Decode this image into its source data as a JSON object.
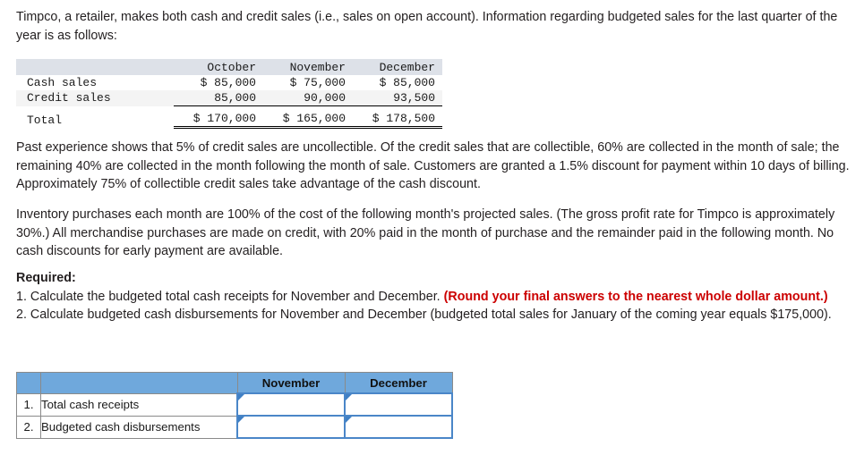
{
  "intro": {
    "text": "Timpco, a retailer, makes both cash and credit sales (i.e., sales on open account). Information regarding budgeted sales for the last quarter of the year is as follows:"
  },
  "sales_table": {
    "columns": [
      "",
      "October",
      "November",
      "December"
    ],
    "rows": [
      {
        "label": "Cash sales",
        "october": "$ 85,000",
        "november": "$ 75,000",
        "december": "$ 85,000"
      },
      {
        "label": "Credit sales",
        "october": "85,000",
        "november": "90,000",
        "december": "93,500"
      },
      {
        "label": "Total",
        "october": "$ 170,000",
        "november": "$ 165,000",
        "december": "$ 178,500"
      }
    ]
  },
  "paragraphs": {
    "credit_terms": "Past experience shows that 5% of credit sales are uncollectible. Of the credit sales that are collectible, 60% are collected in the month of sale; the remaining 40% are collected in the month following the month of sale. Customers are granted a 1.5% discount for payment within 10 days of billing. Approximately 75% of collectible credit sales take advantage of the cash discount.",
    "inventory_terms": "Inventory purchases each month are 100% of the cost of the following month's projected sales. (The gross profit rate for Timpco is approximately 30%.) All merchandise purchases are made on credit, with 20% paid in the month of purchase and the remainder paid in the following month. No cash discounts for early payment are available."
  },
  "required": {
    "heading": "Required:",
    "item1_before": "1. Calculate the budgeted total cash receipts for November and December.",
    "item1_red": "(Round your final answers to the nearest whole dollar amount.)",
    "item2": "2. Calculate budgeted cash disbursements for November and December (budgeted total sales for January of the coming year equals $175,000)."
  },
  "answer_table": {
    "headers": {
      "num": "",
      "desc": "",
      "november": "November",
      "december": "December"
    },
    "rows": [
      {
        "num": "1.",
        "desc": "Total cash receipts",
        "november": "",
        "december": ""
      },
      {
        "num": "2.",
        "desc": "Budgeted cash disbursements",
        "november": "",
        "december": ""
      }
    ]
  },
  "colors": {
    "red_emphasis": "#cc0000",
    "header_blue": "#6fa8dc",
    "input_border_blue": "#4a86c8",
    "table_header_grey": "#dde1e8",
    "row_shade_grey": "#f4f4f4"
  }
}
